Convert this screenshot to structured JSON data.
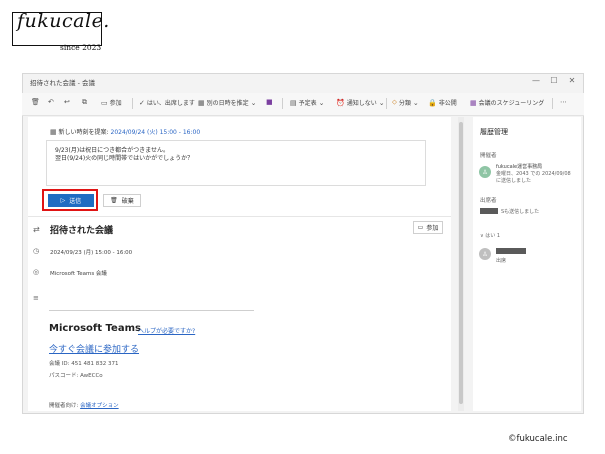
{
  "logo": {
    "text": "fukucale.",
    "since": "since 2023"
  },
  "window": {
    "title": "招待された会議 - 会議",
    "controls": [
      "—",
      "☐",
      "✕"
    ]
  },
  "toolbar": {
    "items": [
      {
        "icon": "trash-icon",
        "glyph": "🗑",
        "label": ""
      },
      {
        "icon": "reply-icon",
        "glyph": "↶",
        "label": ""
      },
      {
        "icon": "undo-icon",
        "glyph": "↩",
        "label": ""
      },
      {
        "icon": "copy-icon",
        "glyph": "⧉",
        "label": ""
      },
      {
        "icon": "video-icon",
        "glyph": "▭",
        "label": "参加"
      },
      {
        "icon": "check-icon",
        "glyph": "✓",
        "label": "はい、出席します"
      },
      {
        "icon": "calendar-icon",
        "glyph": "▦",
        "label": "別の日時を推定"
      },
      {
        "icon": "onenote-icon",
        "glyph": "■",
        "label": ""
      },
      {
        "icon": "folder-icon",
        "glyph": "▤",
        "label": "予定表"
      },
      {
        "icon": "alarm-icon",
        "glyph": "⏰",
        "label": "通知しない"
      },
      {
        "icon": "tag-icon",
        "glyph": "⬦",
        "label": "分類"
      },
      {
        "icon": "lock-icon",
        "glyph": "🔒",
        "label": "非公開"
      },
      {
        "icon": "scheduling-icon",
        "glyph": "▦",
        "label": "会議のスケジューリング"
      },
      {
        "icon": "more-icon",
        "glyph": "⋯",
        "label": ""
      }
    ]
  },
  "proposal": {
    "label": "新しい時刻を提案:",
    "datetime": "2024/09/24 (火) 15:00 - 16:00"
  },
  "message": {
    "line1": "9/23(月)は祝日につき都合がつきません。",
    "line2": "翌日(9/24)火の同じ時間帯ではいかがでしょうか？"
  },
  "actions": {
    "send_label": "送信",
    "delete_label": "破棄"
  },
  "event": {
    "title": "招待された会議",
    "join_label": "参加",
    "datetime": "2024/09/23 (月) 15:00 - 16:00",
    "location": "Microsoft Teams 会議"
  },
  "teams": {
    "title": "Microsoft Teams",
    "help": "ヘルプが必要ですか?",
    "join": "今すぐ会議に参加する",
    "meeting_id": "会議 ID: 451 481 832 371",
    "passcode": "パスコード: AwECCo",
    "organizer_prefix": "開催者向け: ",
    "organizer_link": "会議オプション"
  },
  "side": {
    "title": "履歴管理",
    "organizer_label": "開催者",
    "organizer_name": "fukucale運営事務局",
    "organizer_note1": "金曜日、2043 での 2024/09/08",
    "organizer_note2": "に送信しました",
    "attendee_label": "出席者",
    "attendee_note": "Sも送信しました",
    "section_label": "∨  はい 1",
    "reply_status": "出席"
  },
  "copyright": "©fukucale.inc"
}
